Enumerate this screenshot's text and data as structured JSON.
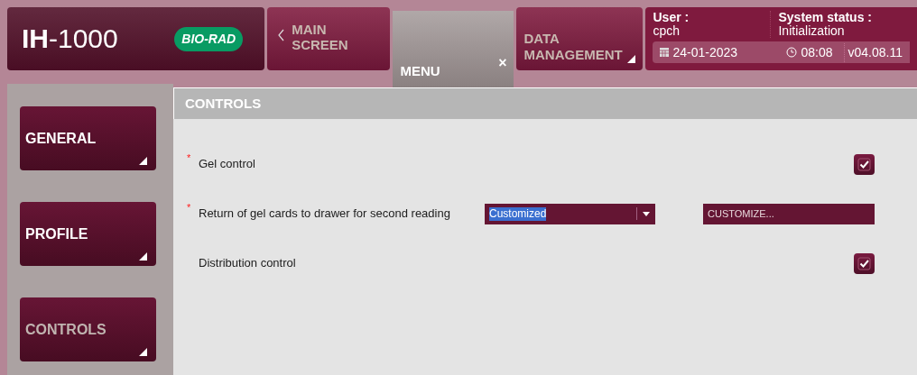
{
  "header": {
    "product": {
      "bold": "IH",
      "rest": "-1000"
    },
    "brand": "BIO-RAD",
    "nav": [
      {
        "kind": "back",
        "label": "MAIN SCREEN",
        "selected": false
      },
      {
        "kind": "menu",
        "label": "MENU",
        "close": "×",
        "selected": true
      },
      {
        "kind": "dropdown",
        "label": "DATA MANAGEMENT",
        "selected": false
      }
    ],
    "status": {
      "user_label": "User :",
      "user": "cpch",
      "system_label": "System status :",
      "system": "Initialization",
      "date": "24-01-2023",
      "time": "08:08",
      "version": "v04.08.11"
    }
  },
  "sidebar": {
    "items": [
      {
        "label": "GENERAL",
        "selected": false
      },
      {
        "label": "PROFILE",
        "selected": false
      },
      {
        "label": "CONTROLS",
        "selected": true
      }
    ]
  },
  "panel": {
    "title": "CONTROLS",
    "rows": [
      {
        "kind": "checkbox",
        "label": "Gel control",
        "required_mark": "*",
        "checked": true
      },
      {
        "kind": "select",
        "label": "Return of gel cards to drawer for second reading",
        "required_mark": "*",
        "value": "Customized",
        "button": "CUSTOMIZE..."
      },
      {
        "kind": "checkbox",
        "label": "Distribution control",
        "checked": true
      }
    ]
  }
}
